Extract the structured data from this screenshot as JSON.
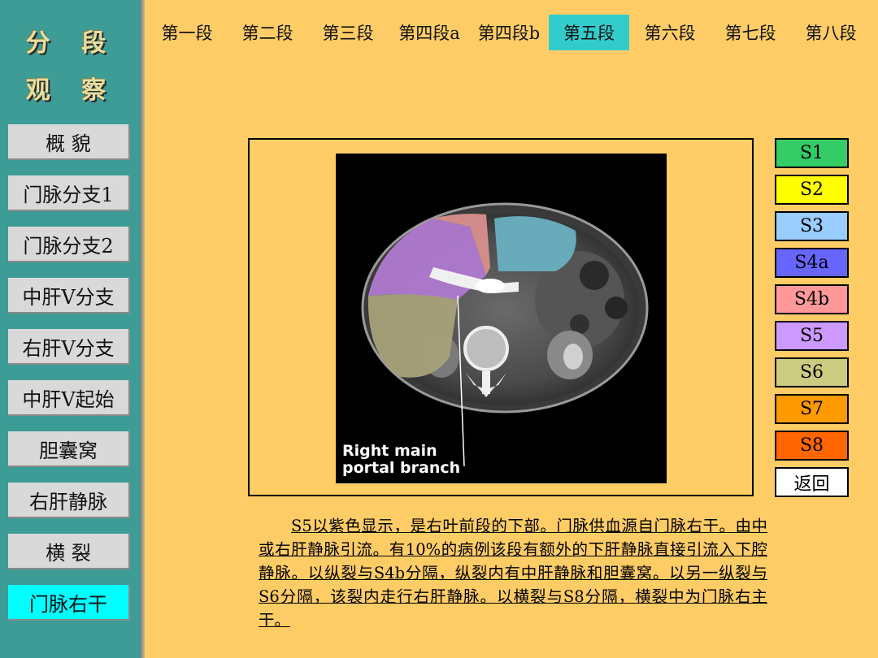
{
  "sidebar": {
    "title_line1": "分 段",
    "title_line2": "观 察",
    "items": [
      {
        "label": "概  貌"
      },
      {
        "label": "门脉分支1"
      },
      {
        "label": "门脉分支2"
      },
      {
        "label": "中肝V分支"
      },
      {
        "label": "右肝V分支"
      },
      {
        "label": "中肝V起始"
      },
      {
        "label": "胆囊窝"
      },
      {
        "label": "右肝静脉"
      },
      {
        "label": "横 裂"
      },
      {
        "label": "门脉右干"
      }
    ],
    "active_index": 9
  },
  "tabs": [
    {
      "label": "第一段"
    },
    {
      "label": "第二段"
    },
    {
      "label": "第三段"
    },
    {
      "label": "第四段a"
    },
    {
      "label": "第四段b"
    },
    {
      "label": "第五段"
    },
    {
      "label": "第六段"
    },
    {
      "label": "第七段"
    },
    {
      "label": "第八段"
    }
  ],
  "active_tab": 5,
  "image": {
    "annotation": "Right main\nportal branch"
  },
  "segments": [
    {
      "label": "S1",
      "color": "#33cc66"
    },
    {
      "label": "S2",
      "color": "#ffff00"
    },
    {
      "label": "S3",
      "color": "#99ccff"
    },
    {
      "label": "S4a",
      "color": "#6666ff"
    },
    {
      "label": "S4b",
      "color": "#ff9999"
    },
    {
      "label": "S5",
      "color": "#cc99ff"
    },
    {
      "label": "S6",
      "color": "#cccc80"
    },
    {
      "label": "S7",
      "color": "#ff9900"
    },
    {
      "label": "S8",
      "color": "#ff6600"
    },
    {
      "label": "返回",
      "color": "#ffffff"
    }
  ],
  "description": "S5以紫色显示，是右叶前段的下部。门脉供血源自门脉右干。由中或右肝静脉引流。有10%的病例该段有额外的下肝静脉直接引流入下腔静脉。以纵裂与S4b分隔，纵裂内有中肝静脉和胆囊窝。以另一纵裂与S6分隔，该裂内走行右肝静脉。以横裂与S8分隔，横裂中为门脉右主干。"
}
